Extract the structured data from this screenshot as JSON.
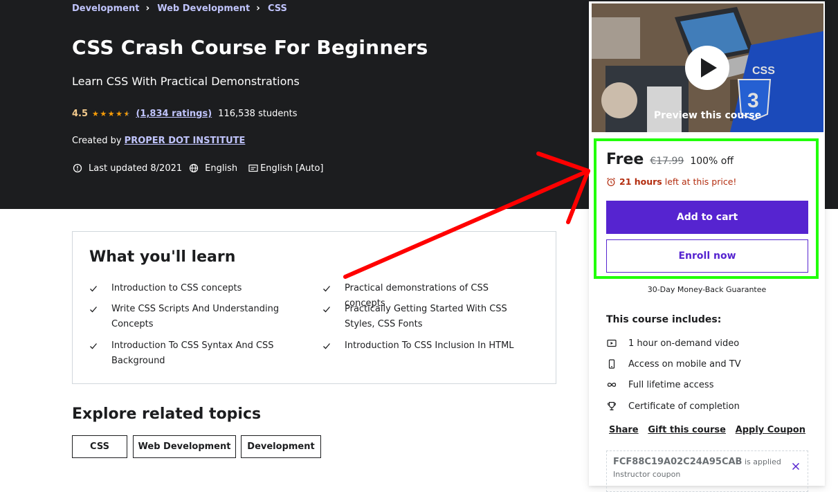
{
  "breadcrumb": [
    "Development",
    "Web Development",
    "CSS"
  ],
  "course": {
    "title": "CSS Crash Course For Beginners",
    "subtitle": "Learn CSS With Practical Demonstrations",
    "rating": "4.5",
    "rating_value": 4.5,
    "ratings_count": "(1,834 ratings)",
    "students": "116,538 students",
    "created_by_label": "Created by",
    "instructor": "PROPER DOT INSTITUTE",
    "last_updated": "Last updated 8/2021",
    "language": "English",
    "captions": "English [Auto]"
  },
  "learn": {
    "title": "What you'll learn",
    "items": [
      "Introduction to CSS concepts",
      "Practical demonstrations of CSS concepts",
      "Write CSS Scripts And Understanding Concepts",
      "Practically Getting Started With CSS Styles, CSS Fonts",
      "Introduction To CSS Syntax And CSS Background",
      "Introduction To CSS Inclusion In HTML"
    ]
  },
  "explore": {
    "title": "Explore related topics",
    "topics": [
      "CSS",
      "Web Development",
      "Development"
    ]
  },
  "sidebar": {
    "preview_label": "Preview this course",
    "price": "Free",
    "original_price": "€17.99",
    "discount": "100% off",
    "timer_hours": "21 hours",
    "timer_text": "left at this price!",
    "add_to_cart": "Add to cart",
    "enroll_now": "Enroll now",
    "guarantee": "30-Day Money-Back Guarantee",
    "includes_title": "This course includes:",
    "includes": [
      {
        "icon": "video-icon",
        "label": "1 hour on-demand video"
      },
      {
        "icon": "mobile-icon",
        "label": "Access on mobile and TV"
      },
      {
        "icon": "infinity-icon",
        "label": "Full lifetime access"
      },
      {
        "icon": "trophy-icon",
        "label": "Certificate of completion"
      }
    ],
    "links": [
      "Share",
      "Gift this course",
      "Apply Coupon"
    ],
    "coupon_code": "FCF88C19A02C24A95CAB",
    "coupon_applied": "is applied",
    "coupon_note": "Instructor coupon"
  },
  "colors": {
    "hero_bg": "#1c1d1f",
    "accent_purple": "#5624d0",
    "link_lavender": "#c0c4fc",
    "rating_gold": "#f3ca8c",
    "highlight_green": "#21ff0a",
    "annotation_red": "#ff0000"
  }
}
